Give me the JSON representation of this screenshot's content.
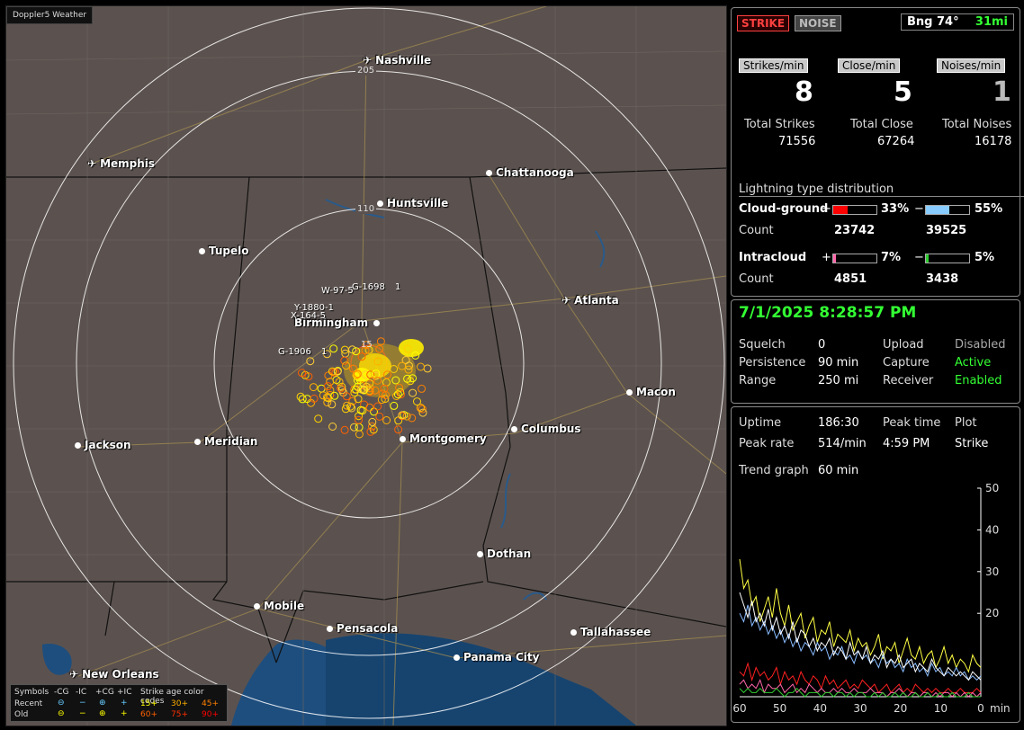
{
  "app_title": "Doppler5 Weather",
  "map": {
    "cities": [
      {
        "name": "Nashville",
        "airport": true
      },
      {
        "name": "Memphis",
        "airport": true
      },
      {
        "name": "Chattanooga",
        "airport": false
      },
      {
        "name": "Huntsville",
        "airport": false
      },
      {
        "name": "Tupelo",
        "airport": false
      },
      {
        "name": "Atlanta",
        "airport": true
      },
      {
        "name": "Birmingham",
        "airport": false
      },
      {
        "name": "Macon",
        "airport": false
      },
      {
        "name": "Jackson",
        "airport": false
      },
      {
        "name": "Meridian",
        "airport": false
      },
      {
        "name": "Montgomery",
        "airport": false
      },
      {
        "name": "Columbus",
        "airport": false
      },
      {
        "name": "Dothan",
        "airport": false
      },
      {
        "name": "Mobile",
        "airport": false
      },
      {
        "name": "Pensacola",
        "airport": false
      },
      {
        "name": "Tallahassee",
        "airport": false
      },
      {
        "name": "Panama City",
        "airport": false
      },
      {
        "name": "New Orleans",
        "airport": true
      }
    ],
    "range_labels": [
      "205",
      "110",
      "15"
    ],
    "cell_labels": [
      "W-97-5",
      "G-1698",
      "1",
      "Y-1880-1",
      "X-164-5",
      "G-1906",
      "1"
    ]
  },
  "legend": {
    "symbols_label": "Symbols",
    "headers": [
      "-CG",
      "-IC",
      "+CG",
      "+IC"
    ],
    "age_label": "Strike age color codes",
    "recent_label": "Recent",
    "old_label": "Old",
    "recent_ages": [
      "15+",
      "30+",
      "45+"
    ],
    "old_ages": [
      "60+",
      "75+",
      "90+"
    ],
    "recent_colors": [
      "#ffff00",
      "#ffb000",
      "#ff8000"
    ],
    "old_colors": [
      "#ff6000",
      "#ff3000",
      "#ff0000"
    ],
    "glyphs": [
      "⊖",
      "−",
      "⊕",
      "+"
    ]
  },
  "panel1": {
    "strike_btn": "STRIKE",
    "noise_btn": "NOISE",
    "bearing": "Bng 74°",
    "distance": "31mi",
    "rates": [
      {
        "label": "Strikes/min",
        "value": "8"
      },
      {
        "label": "Close/min",
        "value": "5"
      },
      {
        "label": "Noises/min",
        "value": "1"
      }
    ],
    "totals": [
      {
        "label": "Total Strikes",
        "value": "71556"
      },
      {
        "label": "Total Close",
        "value": "67264"
      },
      {
        "label": "Total Noises",
        "value": "16178"
      }
    ],
    "dist_title": "Lightning type distribution",
    "cg_label": "Cloud-ground",
    "ic_label": "Intracloud",
    "count_label": "Count",
    "plus": "+",
    "minus": "−",
    "cg_pos_pct": "33%",
    "cg_neg_pct": "55%",
    "cg_pos_count": "23742",
    "cg_neg_count": "39525",
    "ic_pos_pct": "7%",
    "ic_neg_pct": "5%",
    "ic_pos_count": "4851",
    "ic_neg_count": "3438",
    "bar_levels": {
      "cg_pos": 0.33,
      "cg_neg": 0.55,
      "ic_pos": 0.07,
      "ic_neg": 0.05
    },
    "bar_colors": {
      "cg_pos": "#ff0000",
      "cg_neg": "#88ccff",
      "ic_pos": "#ff66aa",
      "ic_neg": "#33cc33"
    }
  },
  "panel2": {
    "datetime": "7/1/2025 8:28:57 PM",
    "rows": [
      {
        "k1": "Squelch",
        "v1": "0",
        "k2": "Upload",
        "v2": "Disabled",
        "v2_green": false
      },
      {
        "k1": "Persistence",
        "v1": "90 min",
        "k2": "Capture",
        "v2": "Active",
        "v2_green": true
      },
      {
        "k1": "Range",
        "v1": "250 mi",
        "k2": "Receiver",
        "v2": "Enabled",
        "v2_green": true
      }
    ]
  },
  "panel3": {
    "uptime_label": "Uptime",
    "uptime": "186:30",
    "peak_time_label": "Peak time",
    "peak_time": "4:59 PM",
    "plot_label": "Plot",
    "plot_value": "Strike",
    "peak_rate_label": "Peak rate",
    "peak_rate": "514/min",
    "trend_label": "Trend graph",
    "trend_value": "60 min"
  },
  "chart_data": {
    "type": "line",
    "title": "",
    "xlabel": "min",
    "ylabel": "",
    "x_ticks": [
      "60",
      "50",
      "40",
      "30",
      "20",
      "10",
      "0"
    ],
    "y_ticks": [
      "50",
      "40",
      "30",
      "20"
    ],
    "ylim": [
      0,
      50
    ],
    "xlim": [
      60,
      0
    ],
    "series_colors": [
      "#ffff44",
      "#88bbff",
      "#ffffff",
      "#ff2020",
      "#ff66aa",
      "#33cc33"
    ],
    "series": [
      {
        "values": [
          33,
          26,
          28,
          22,
          24,
          18,
          21,
          24,
          19,
          26,
          20,
          17,
          22,
          16,
          18,
          20,
          14,
          17,
          19,
          13,
          16,
          15,
          18,
          12,
          15,
          14,
          13,
          16,
          11,
          14,
          12,
          13,
          10,
          12,
          15,
          9,
          12,
          11,
          13,
          8,
          11,
          14,
          10,
          9,
          12,
          8,
          10,
          11,
          7,
          9,
          12,
          8,
          10,
          7,
          9,
          8,
          6,
          10,
          8,
          7
        ]
      },
      {
        "values": [
          20,
          18,
          22,
          17,
          19,
          16,
          18,
          15,
          17,
          14,
          16,
          13,
          15,
          12,
          14,
          11,
          13,
          12,
          10,
          13,
          11,
          12,
          9,
          11,
          10,
          12,
          9,
          10,
          8,
          11,
          9,
          10,
          8,
          9,
          7,
          10,
          8,
          9,
          7,
          8,
          6,
          9,
          7,
          8,
          6,
          7,
          5,
          8,
          6,
          7,
          5,
          6,
          5,
          7,
          5,
          6,
          4,
          5,
          4,
          5
        ]
      },
      {
        "values": [
          25,
          22,
          19,
          23,
          18,
          20,
          17,
          21,
          16,
          19,
          15,
          17,
          14,
          18,
          13,
          16,
          15,
          12,
          14,
          11,
          13,
          12,
          14,
          10,
          12,
          11,
          9,
          13,
          10,
          11,
          9,
          12,
          8,
          10,
          9,
          11,
          7,
          9,
          8,
          10,
          7,
          8,
          9,
          6,
          8,
          7,
          6,
          9,
          7,
          6,
          5,
          7,
          6,
          5,
          6,
          5,
          4,
          6,
          5,
          4
        ]
      },
      {
        "values": [
          6,
          5,
          8,
          4,
          7,
          5,
          6,
          4,
          5,
          7,
          3,
          6,
          4,
          5,
          3,
          6,
          4,
          3,
          5,
          4,
          2,
          5,
          3,
          4,
          2,
          3,
          4,
          2,
          3,
          2,
          4,
          3,
          2,
          3,
          1,
          2,
          3,
          1,
          2,
          3,
          1,
          2,
          1,
          3,
          2,
          1,
          2,
          1,
          2,
          1,
          1,
          2,
          1,
          1,
          2,
          1,
          1,
          1,
          2,
          1
        ]
      },
      {
        "values": [
          3,
          4,
          2,
          3,
          2,
          4,
          1,
          3,
          2,
          2,
          3,
          1,
          2,
          3,
          1,
          2,
          1,
          3,
          2,
          1,
          2,
          1,
          1,
          2,
          1,
          2,
          1,
          1,
          2,
          1,
          1,
          1,
          2,
          1,
          1,
          1,
          0,
          1,
          1,
          2,
          1,
          0,
          1,
          1,
          0,
          1,
          1,
          0,
          1,
          0,
          1,
          1,
          0,
          1,
          0,
          1,
          0,
          1,
          0,
          1
        ]
      },
      {
        "values": [
          2,
          1,
          2,
          1,
          1,
          2,
          1,
          1,
          1,
          2,
          1,
          0,
          1,
          1,
          2,
          1,
          0,
          1,
          1,
          1,
          0,
          1,
          1,
          0,
          1,
          1,
          0,
          1,
          0,
          1,
          1,
          0,
          0,
          1,
          0,
          1,
          0,
          0,
          1,
          0,
          1,
          0,
          0,
          1,
          0,
          0,
          1,
          0,
          0,
          1,
          0,
          0,
          1,
          0,
          0,
          0,
          1,
          0,
          0,
          0
        ]
      }
    ]
  }
}
